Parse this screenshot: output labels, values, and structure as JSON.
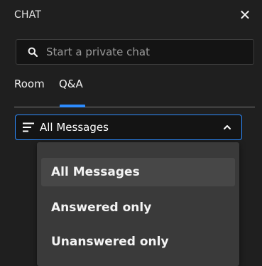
{
  "header": {
    "title": "CHAT",
    "close_symbol": "✕"
  },
  "search": {
    "placeholder": "Start a private chat",
    "icon": "search-icon"
  },
  "tabs": [
    {
      "label": "Room",
      "active": false
    },
    {
      "label": "Q&A",
      "active": true
    }
  ],
  "filter": {
    "selected_label": "All Messages",
    "icon": "filter-lines-icon",
    "expanded": true
  },
  "dropdown": {
    "options": [
      {
        "label": "All Messages",
        "selected": true
      },
      {
        "label": "Answered only",
        "selected": false
      },
      {
        "label": "Unanswered only",
        "selected": false
      }
    ]
  },
  "colors": {
    "accent": "#2d8cff",
    "background": "#1f1f1f",
    "dropdown_bg": "#3a3a3a",
    "selected_bg": "#474747"
  }
}
